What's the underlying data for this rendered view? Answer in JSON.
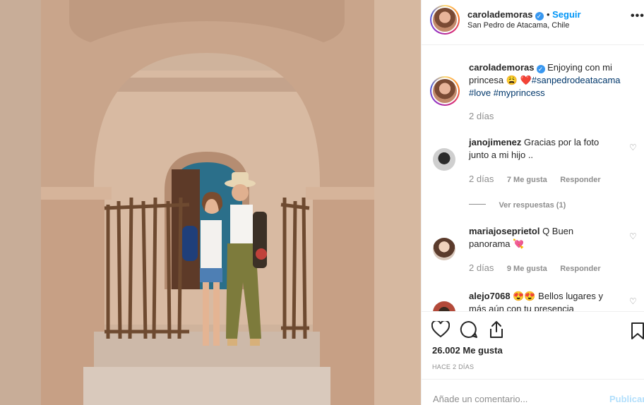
{
  "post": {
    "username": "carolademoras",
    "follow_label": "Seguir",
    "location": "San Pedro de Atacama, Chile",
    "caption_text": "Enjoying con mi princesa",
    "caption_emoji": "😩",
    "caption_heart": "❤️",
    "caption_tags": [
      "#sanpedrodeatacama",
      "#love",
      "#myprincess"
    ],
    "caption_time": "2 días",
    "likes": "26.002 Me gusta",
    "date": "HACE 2 DÍAS"
  },
  "comments": [
    {
      "username": "janojimenez",
      "text": "Gracias por la foto junto a mi hijo ..",
      "time": "2 días",
      "likes": "7 Me gusta",
      "reply": "Responder",
      "view_replies": "Ver respuestas (1)"
    },
    {
      "username": "mariajoseprietol",
      "text": "Q Buen panorama",
      "emoji": "💘",
      "time": "2 días",
      "likes": "9 Me gusta",
      "reply": "Responder"
    },
    {
      "username": "alejo7068",
      "emoji": "😍",
      "text": "Bellos lugares y más aún con tu presencia"
    }
  ],
  "add_comment": {
    "placeholder": "Añade un comentario...",
    "publish_label": "Publicar"
  },
  "icons": {
    "verified": "verified-badge-icon",
    "like": "heart-icon",
    "comment": "comment-bubble-icon",
    "share": "share-icon",
    "save": "bookmark-icon",
    "more": "more-options-icon"
  },
  "colors": {
    "link": "#0095f6",
    "hashtag": "#00376b",
    "muted": "#8e8e8e",
    "publish_disabled": "#b2dffc"
  }
}
